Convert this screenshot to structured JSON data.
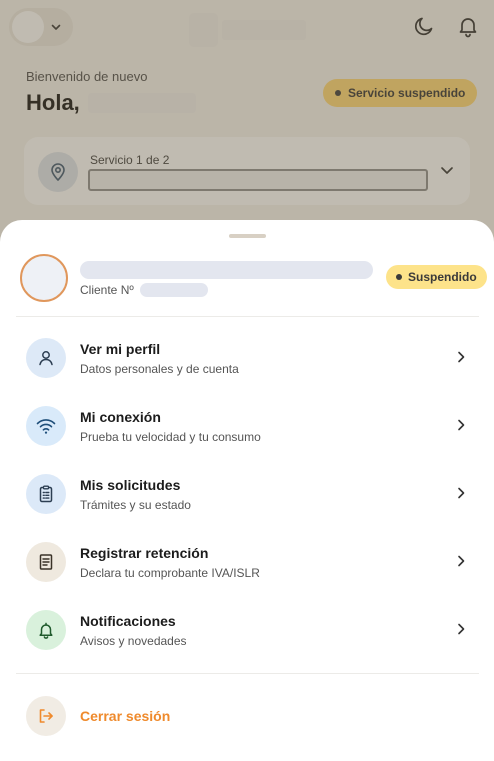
{
  "header": {
    "welcome": "Bienvenido de nuevo",
    "greeting": "Hola,",
    "service_status": "Servicio suspendido"
  },
  "service_card": {
    "label": "Servicio 1 de 2"
  },
  "sheet": {
    "client_label": "Cliente Nº",
    "status_badge": "Suspendido",
    "menu": [
      {
        "title": "Ver mi perfil",
        "subtitle": "Datos personales y de cuenta",
        "icon": "user-icon",
        "icon_bg": "#dde9f7"
      },
      {
        "title": "Mi conexión",
        "subtitle": "Prueba tu velocidad y tu consumo",
        "icon": "wifi-icon",
        "icon_bg": "#d9eafa"
      },
      {
        "title": "Mis solicitudes",
        "subtitle": "Trámites y su estado",
        "icon": "clipboard-icon",
        "icon_bg": "#dce9f8"
      },
      {
        "title": "Registrar retención",
        "subtitle": "Declara tu comprobante IVA/ISLR",
        "icon": "receipt-icon",
        "icon_bg": "#efe9df"
      },
      {
        "title": "Notificaciones",
        "subtitle": "Avisos y novedades",
        "icon": "bell-icon",
        "icon_bg": "#d9f1dc"
      }
    ],
    "logout": "Cerrar sesión"
  },
  "colors": {
    "accent": "#ef8a2c",
    "badge": "#fde38a",
    "scrim": "#695c44"
  }
}
